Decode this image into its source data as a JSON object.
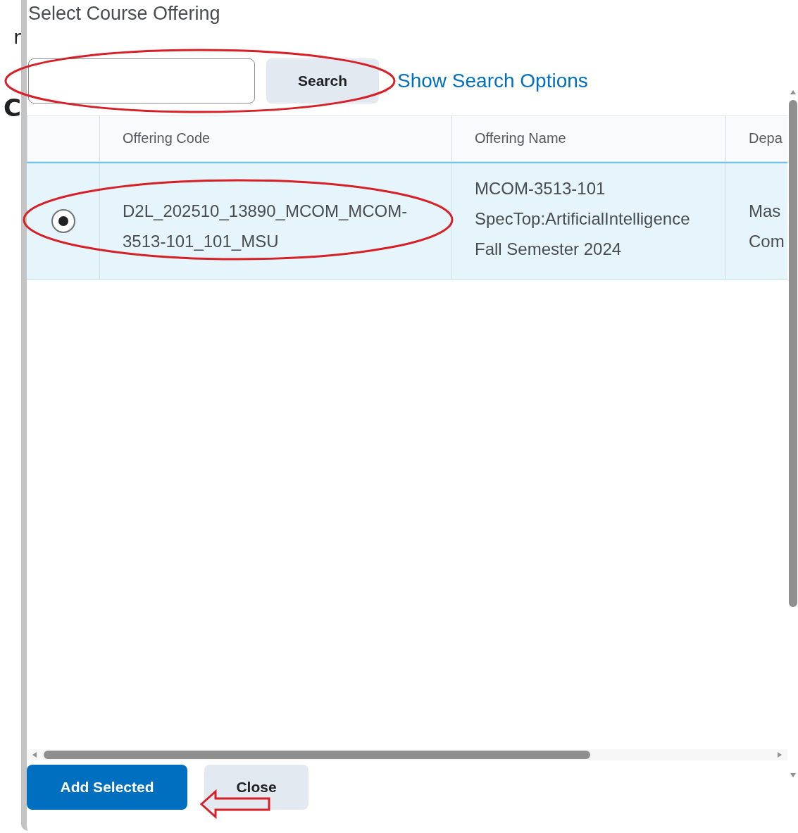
{
  "background_fragments": [
    "r",
    "C"
  ],
  "dialog": {
    "title": "Select Course Offering",
    "search": {
      "button": "Search",
      "link": "Show Search Options",
      "circled": true
    },
    "table": {
      "columns": [
        "Offering Code",
        "Offering Name",
        "Depa"
      ],
      "rows": [
        {
          "selected": true,
          "circled": true,
          "code": "D2L_202510_13890_MCOM_MCOM-3513-101_101_MSU",
          "name_lines": [
            "MCOM-3513-101",
            "SpecTop:ArtificialIntelligence",
            "Fall Semester 2024"
          ],
          "department_lines": [
            "Mas",
            "Com"
          ]
        }
      ]
    },
    "buttons": [
      {
        "label": "Add Selected",
        "kind": "primary",
        "arrow_marked": false
      },
      {
        "label": "Close",
        "kind": "secondary",
        "arrow_marked": true
      }
    ]
  }
}
